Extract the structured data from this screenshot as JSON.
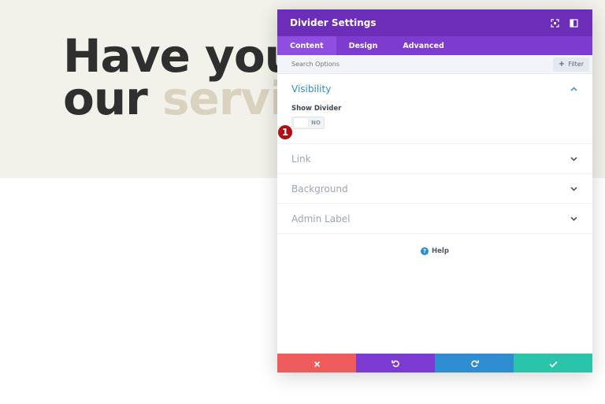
{
  "hero": {
    "line1": "Have you s",
    "line2_plain": "our ",
    "line2_accent": "servic"
  },
  "modal": {
    "title": "Divider Settings",
    "tabs": [
      {
        "label": "Content",
        "active": true
      },
      {
        "label": "Design",
        "active": false
      },
      {
        "label": "Advanced",
        "active": false
      }
    ],
    "search": {
      "placeholder": "Search Options"
    },
    "filter_label": "Filter",
    "sections": [
      {
        "title": "Visibility",
        "open": true
      },
      {
        "title": "Link",
        "open": false
      },
      {
        "title": "Background",
        "open": false
      },
      {
        "title": "Admin Label",
        "open": false
      }
    ],
    "visibility": {
      "field_label": "Show Divider",
      "toggle_value": "NO"
    },
    "badge": "1",
    "help_label": "Help"
  },
  "colors": {
    "header": "#6c2eb9",
    "tabs": "#7e3bd0",
    "discard": "#ef5b5b",
    "undo": "#7b3ad2",
    "redo": "#2e8cd1",
    "save": "#29c4a9"
  },
  "icons": {
    "header": [
      "expand-icon",
      "sidebar-toggle-icon"
    ],
    "footer": [
      "close-icon",
      "undo-icon",
      "redo-icon",
      "check-icon"
    ]
  }
}
